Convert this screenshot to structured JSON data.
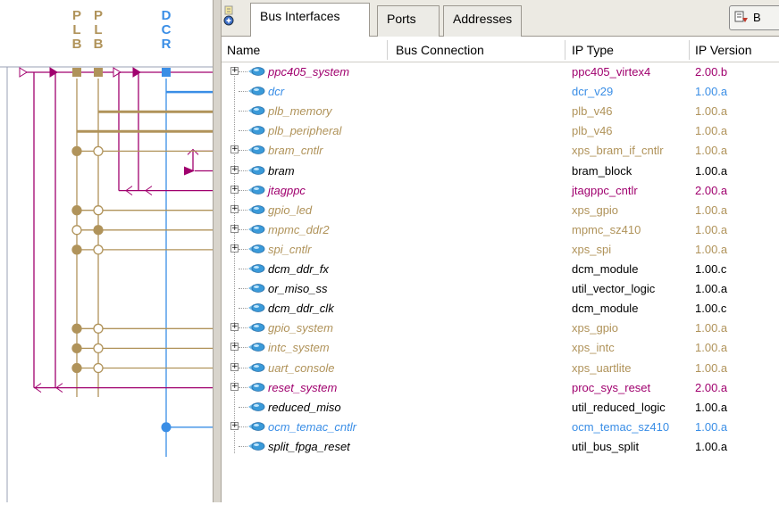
{
  "colors": {
    "plb": "#b0935a",
    "dcr": "#3a8ee6",
    "mhs": "#a0006e",
    "normal": "#000000"
  },
  "bus_header": {
    "columns": [
      {
        "letters": [
          "P",
          "L",
          "B"
        ]
      },
      {
        "letters": [
          "P",
          "L",
          "B"
        ]
      },
      {
        "letters": [
          "D",
          "C",
          "R"
        ]
      }
    ]
  },
  "tabs": [
    {
      "label": "Bus Interfaces",
      "active": true
    },
    {
      "label": "Ports",
      "active": false
    },
    {
      "label": "Addresses",
      "active": false
    }
  ],
  "toolbar": {
    "button_label": "B",
    "icon": "filter-icon"
  },
  "columns": {
    "name": "Name",
    "bus_connection": "Bus Connection",
    "ip_type": "IP Type",
    "ip_version": "IP Version"
  },
  "instances": [
    {
      "name": "ppc405_system",
      "type": "ppc405_virtex4",
      "version": "2.00.b",
      "color": "mhs",
      "expandable": true
    },
    {
      "name": "dcr",
      "type": "dcr_v29",
      "version": "1.00.a",
      "color": "dcr",
      "expandable": false
    },
    {
      "name": "plb_memory",
      "type": "plb_v46",
      "version": "1.00.a",
      "color": "plb",
      "expandable": false
    },
    {
      "name": "plb_peripheral",
      "type": "plb_v46",
      "version": "1.00.a",
      "color": "plb",
      "expandable": false
    },
    {
      "name": "bram_cntlr",
      "type": "xps_bram_if_cntlr",
      "version": "1.00.a",
      "color": "plb",
      "expandable": true
    },
    {
      "name": "bram",
      "type": "bram_block",
      "version": "1.00.a",
      "color": "normal",
      "expandable": true
    },
    {
      "name": "jtagppc",
      "type": "jtagppc_cntlr",
      "version": "2.00.a",
      "color": "mhs",
      "expandable": true
    },
    {
      "name": "gpio_led",
      "type": "xps_gpio",
      "version": "1.00.a",
      "color": "plb",
      "expandable": true
    },
    {
      "name": "mpmc_ddr2",
      "type": "mpmc_sz410",
      "version": "1.00.a",
      "color": "plb",
      "expandable": true
    },
    {
      "name": "spi_cntlr",
      "type": "xps_spi",
      "version": "1.00.a",
      "color": "plb",
      "expandable": true
    },
    {
      "name": "dcm_ddr_fx",
      "type": "dcm_module",
      "version": "1.00.c",
      "color": "normal",
      "expandable": false
    },
    {
      "name": "or_miso_ss",
      "type": "util_vector_logic",
      "version": "1.00.a",
      "color": "normal",
      "expandable": false
    },
    {
      "name": "dcm_ddr_clk",
      "type": "dcm_module",
      "version": "1.00.c",
      "color": "normal",
      "expandable": false
    },
    {
      "name": "gpio_system",
      "type": "xps_gpio",
      "version": "1.00.a",
      "color": "plb",
      "expandable": true
    },
    {
      "name": "intc_system",
      "type": "xps_intc",
      "version": "1.00.a",
      "color": "plb",
      "expandable": true
    },
    {
      "name": "uart_console",
      "type": "xps_uartlite",
      "version": "1.00.a",
      "color": "plb",
      "expandable": true
    },
    {
      "name": "reset_system",
      "type": "proc_sys_reset",
      "version": "2.00.a",
      "color": "mhs",
      "expandable": true
    },
    {
      "name": "reduced_miso",
      "type": "util_reduced_logic",
      "version": "1.00.a",
      "color": "normal",
      "expandable": false
    },
    {
      "name": "ocm_temac_cntlr",
      "type": "ocm_temac_sz410",
      "version": "1.00.a",
      "color": "dcr",
      "expandable": true
    },
    {
      "name": "split_fpga_reset",
      "type": "util_bus_split",
      "version": "1.00.a",
      "color": "normal",
      "expandable": false
    }
  ]
}
